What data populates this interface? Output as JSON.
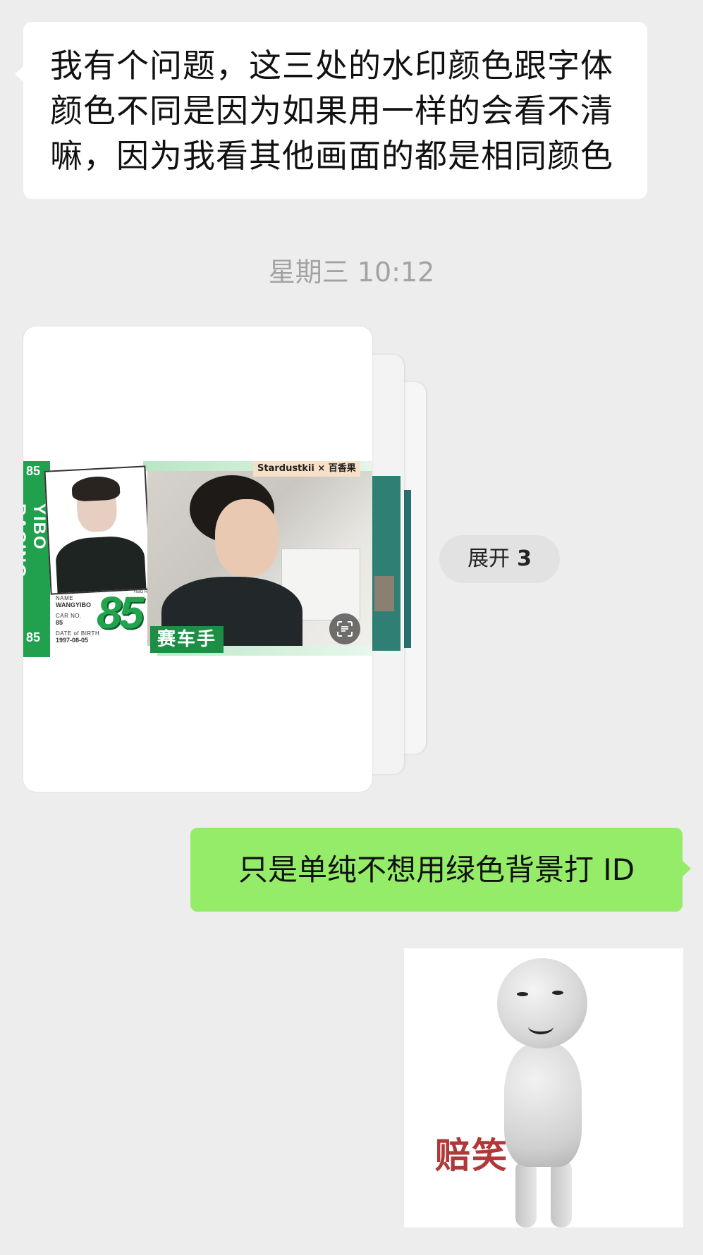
{
  "messages": {
    "incoming_text_lines": [
      "我有个问题，这三处的水印颜色跟字体",
      "颜色不同是因为如果用一样的会看不清",
      "嘛，因为我看其他画面的都是相同颜色"
    ],
    "timestamp": "星期三 10:12",
    "image_card": {
      "watermark": "Stardustkii × 百香果",
      "side_text": "YIBO RACING",
      "side_number": "85",
      "info": {
        "name_label": "NAME",
        "name_value": "WANGYIBO",
        "car_label": "CAR NO.",
        "car_value": "85",
        "dob_label": "DATE of BIRTH",
        "dob_value": "1997-08-05"
      },
      "big_number": "85",
      "big_number_tag": "YIBO RACING",
      "role_label": "赛车手",
      "scan_icon": "scan-text-icon",
      "stack_count_behind": 2
    },
    "expand_button": {
      "label": "展开",
      "count": "3"
    },
    "outgoing_text": "只是单纯不想用绿色背景打 ID",
    "sticker": {
      "caption": "赔笑"
    }
  },
  "colors": {
    "background": "#ededed",
    "incoming_bubble": "#ffffff",
    "outgoing_bubble": "#95ec69",
    "timestamp_text": "#a3a3a3",
    "poster_green": "#22a34e",
    "sticker_text": "#b03838"
  }
}
